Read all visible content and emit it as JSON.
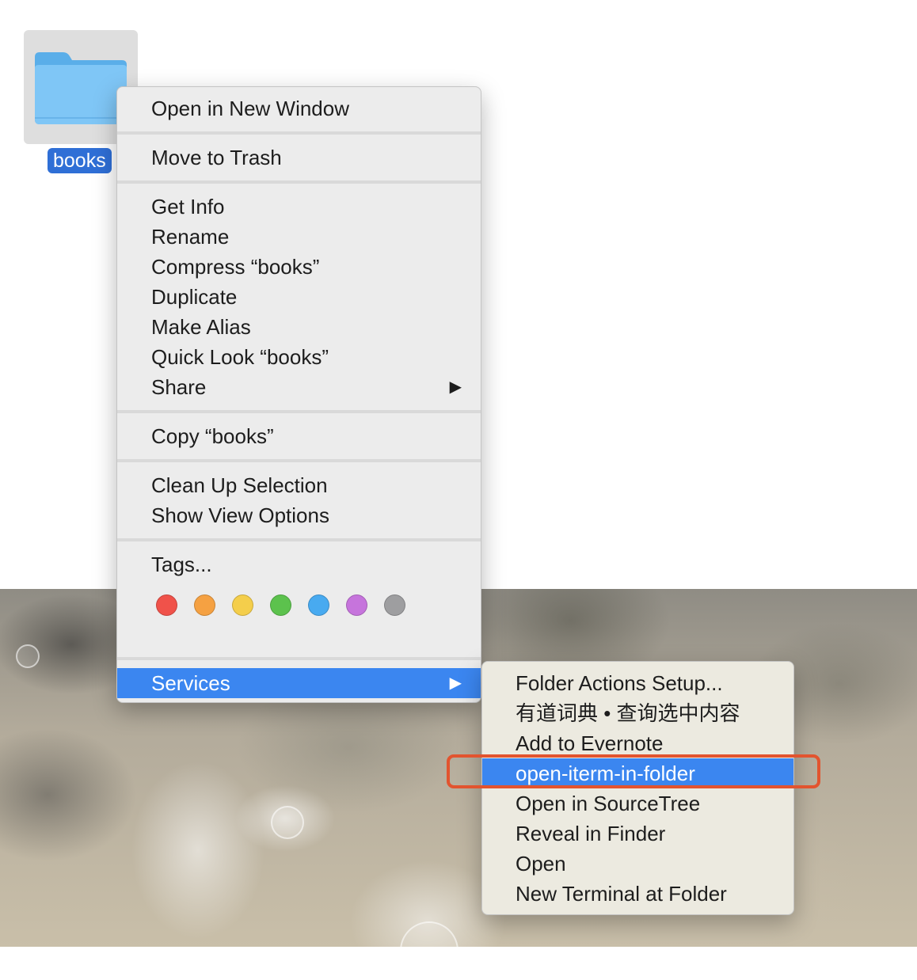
{
  "folder": {
    "name": "books",
    "icon": "folder-icon",
    "color": "#6fbcf2"
  },
  "context_menu": {
    "items": [
      {
        "label": "Open in New Window"
      },
      {
        "label": "Move to Trash"
      },
      {
        "label": "Get Info"
      },
      {
        "label": "Rename"
      },
      {
        "label": "Compress “books”"
      },
      {
        "label": "Duplicate"
      },
      {
        "label": "Make Alias"
      },
      {
        "label": "Quick Look “books”"
      },
      {
        "label": "Share",
        "has_submenu": true
      },
      {
        "label": "Copy “books”"
      },
      {
        "label": "Clean Up Selection"
      },
      {
        "label": "Show View Options"
      },
      {
        "label": "Tags..."
      },
      {
        "label": "Services",
        "has_submenu": true,
        "highlighted": true
      }
    ],
    "submenu_arrow": "▶",
    "tag_colors": [
      "#f0524a",
      "#f5a142",
      "#f4ce4b",
      "#5cc24d",
      "#48aaf0",
      "#c674dc",
      "#9e9ea0"
    ]
  },
  "services_submenu": {
    "items": [
      {
        "label": "Folder Actions Setup..."
      },
      {
        "label": "有道词典 • 查询选中内容"
      },
      {
        "label": "Add to Evernote"
      },
      {
        "label": "open-iterm-in-folder",
        "highlighted": true
      },
      {
        "label": "Open in SourceTree"
      },
      {
        "label": "Reveal in Finder"
      },
      {
        "label": "Open"
      },
      {
        "label": "New Terminal at Folder"
      }
    ]
  },
  "colors": {
    "highlight": "#3b86f0",
    "annotation": "#e2542f",
    "label_selected": "#2f6fd6"
  }
}
